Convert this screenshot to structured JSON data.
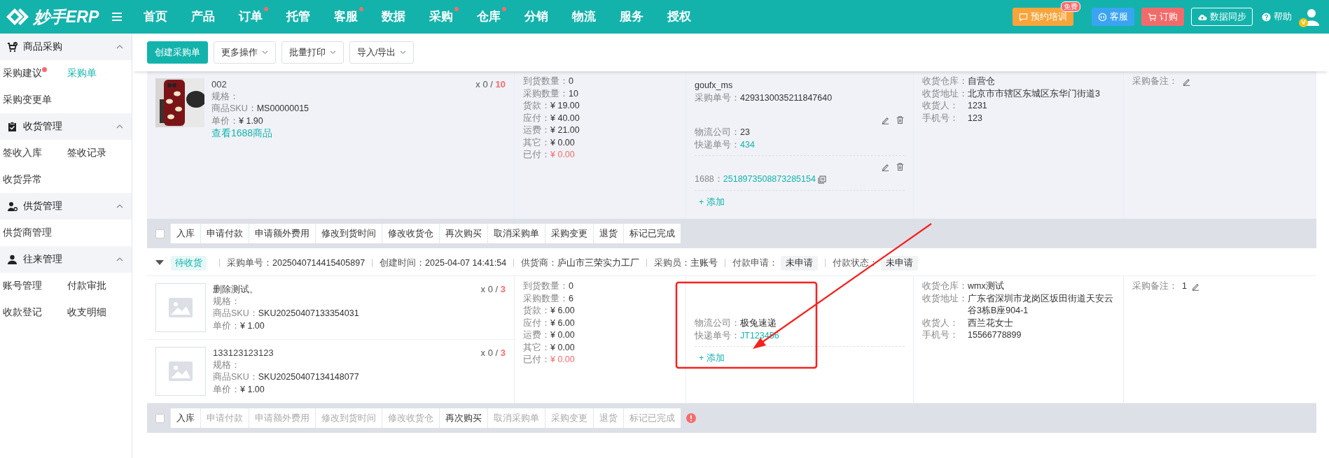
{
  "topbar": {
    "logo": "妙手ERP",
    "nav": [
      {
        "label": "首页",
        "dot": false
      },
      {
        "label": "产品",
        "dot": false
      },
      {
        "label": "订单",
        "dot": true
      },
      {
        "label": "托管",
        "dot": false
      },
      {
        "label": "客服",
        "dot": true
      },
      {
        "label": "数据",
        "dot": false
      },
      {
        "label": "采购",
        "dot": true
      },
      {
        "label": "仓库",
        "dot": true
      },
      {
        "label": "分销",
        "dot": false
      },
      {
        "label": "物流",
        "dot": false
      },
      {
        "label": "服务",
        "dot": false
      },
      {
        "label": "授权",
        "dot": false
      }
    ],
    "actions": [
      {
        "kind": "training",
        "label": "预约培训",
        "badge": "免费"
      },
      {
        "kind": "service",
        "label": "客服"
      },
      {
        "kind": "order",
        "label": "订购"
      },
      {
        "kind": "sync",
        "label": "数据同步"
      },
      {
        "kind": "help",
        "label": "帮助"
      }
    ],
    "avatar_badge": "V"
  },
  "sidebar": [
    {
      "title": "商品采购",
      "expanded": true,
      "items": [
        {
          "label": "采购建议",
          "dot": true,
          "selected": false
        },
        {
          "label": "采购单",
          "dot": false,
          "selected": true
        },
        {
          "label": "采购变更单",
          "dot": false,
          "selected": false
        }
      ]
    },
    {
      "title": "收货管理",
      "expanded": true,
      "items": [
        {
          "label": "签收入库",
          "dot": false,
          "selected": false
        },
        {
          "label": "签收记录",
          "dot": false,
          "selected": false
        },
        {
          "label": "收货异常",
          "dot": false,
          "selected": false
        }
      ]
    },
    {
      "title": "供货管理",
      "expanded": true,
      "items": [
        {
          "label": "供货商管理",
          "dot": false,
          "selected": false
        }
      ]
    },
    {
      "title": "往来管理",
      "expanded": true,
      "items": [
        {
          "label": "账号管理",
          "dot": false,
          "selected": false
        },
        {
          "label": "付款审批",
          "dot": false,
          "selected": false
        },
        {
          "label": "收款登记",
          "dot": false,
          "selected": false
        },
        {
          "label": "收支明细",
          "dot": false,
          "selected": false
        }
      ]
    }
  ],
  "toolbar": [
    {
      "label": "创建采购单",
      "kind": "primary"
    },
    {
      "label": "更多操作",
      "kind": "dropdown"
    },
    {
      "label": "批量打印",
      "kind": "dropdown"
    },
    {
      "label": "导入/导出",
      "kind": "dropdown"
    }
  ],
  "orders": [
    {
      "hovered": true,
      "products": [
        {
          "name": "002",
          "spec": "规格：",
          "sku_label": "商品SKU：",
          "sku": "MS00000015",
          "price_label": "单价：",
          "price": "¥ 1.90",
          "link": "查看1688商品",
          "quantity": "x 0 /",
          "quantity_total": "10"
        }
      ],
      "amounts": [
        {
          "label": "到货数量：",
          "value": "0",
          "alert": false
        },
        {
          "label": "采购数量：",
          "value": "10",
          "alert": false
        },
        {
          "label": "货款：",
          "value": "¥ 19.00",
          "alert": false
        },
        {
          "label": "应付：",
          "value": "¥ 40.00",
          "alert": false
        },
        {
          "label": "运费：",
          "value": "¥ 21.00",
          "alert": false
        },
        {
          "label": "其它：",
          "value": "¥ 0.00",
          "alert": false
        },
        {
          "label": "已付：",
          "value": "¥ 0.00",
          "alert": true
        }
      ],
      "logistics": {
        "account": "goufx_ms",
        "fields": [
          {
            "label": "采购单号：",
            "value": "4293130035211847640"
          }
        ],
        "shipments": [
          {
            "editable": true,
            "copyable": false,
            "fields": [
              {
                "label": "物流公司：",
                "value": "23",
                "link": false
              },
              {
                "label": "快递单号：",
                "value": "434",
                "link": true
              }
            ]
          },
          {
            "editable": true,
            "copyable": true,
            "fields": [
              {
                "label": "1688：",
                "value": "2518973508873285154",
                "link": true
              }
            ]
          }
        ],
        "add": "+ 添加"
      },
      "warehouse": [
        {
          "label": "收货仓库：",
          "value": "自营仓"
        },
        {
          "label": "收货地址：",
          "value": "北京市市辖区东城区东华门街道3"
        },
        {
          "label": "收货人：",
          "value": "1231"
        },
        {
          "label": "手机号：",
          "value": "123"
        }
      ],
      "note": {
        "label": "采购备注："
      },
      "bar": {
        "checked": false,
        "warning": false,
        "buttons": [
          {
            "label": "入库",
            "disabled": false
          },
          {
            "label": "申请付款",
            "disabled": false
          },
          {
            "label": "申请额外费用",
            "disabled": false
          },
          {
            "label": "修改到货时间",
            "disabled": false
          },
          {
            "label": "修改收货仓",
            "disabled": false
          },
          {
            "label": "再次购买",
            "disabled": false
          },
          {
            "label": "取消采购单",
            "disabled": false
          },
          {
            "label": "采购变更",
            "disabled": false
          },
          {
            "label": "退货",
            "disabled": false
          },
          {
            "label": "标记已完成",
            "disabled": false
          }
        ]
      }
    },
    {
      "hovered": false,
      "header": {
        "expanded": true,
        "status": "待收货",
        "fields": [
          {
            "label": "采购单号：",
            "value": "2025040714415405897"
          },
          {
            "label": "创建时间：",
            "value": "2025-04-07 14:41:54"
          },
          {
            "label": "供货商：",
            "value": "庐山市三荣实力工厂"
          },
          {
            "label": "采购员：",
            "value": "主账号"
          },
          {
            "label": "付款申请：",
            "chip": "未申请"
          },
          {
            "label": "付款状态：",
            "chip": "未申请"
          }
        ]
      },
      "products": [
        {
          "image": {
            "kind": "placeholder"
          },
          "name": "删除测试。",
          "spec": "规格：",
          "sku_label": "商品SKU：",
          "sku": "SKU20250407133354031",
          "price_label": "单价：",
          "price": "¥ 1.00",
          "quantity": "x 0 /",
          "quantity_total": "3"
        },
        {
          "image": {
            "kind": "placeholder"
          },
          "name": "133123123123",
          "spec": "规格：",
          "sku_label": "商品SKU：",
          "sku": "SKU20250407134148077",
          "price_label": "单价：",
          "price": "¥ 1.00",
          "quantity": "x 0 /",
          "quantity_total": "3"
        }
      ],
      "amounts": [
        {
          "label": "到货数量：",
          "value": "0",
          "alert": false
        },
        {
          "label": "采购数量：",
          "value": "6",
          "alert": false
        },
        {
          "label": "货款：",
          "value": "¥ 6.00",
          "alert": false
        },
        {
          "label": "应付：",
          "value": "¥ 6.00",
          "alert": false
        },
        {
          "label": "运费：",
          "value": "¥ 0.00",
          "alert": false
        },
        {
          "label": "其它：",
          "value": "¥ 0.00",
          "alert": false
        },
        {
          "label": "已付：",
          "value": "¥ 0.00",
          "alert": true
        }
      ],
      "logistics": {
        "shipments": [
          {
            "editable": false,
            "copyable": false,
            "fields": [
              {
                "label": "物流公司：",
                "value": "极兔速递",
                "link": false
              },
              {
                "label": "快递单号：",
                "value": "JT123456",
                "link": true
              }
            ]
          }
        ],
        "add": "+ 添加"
      },
      "warehouse": [
        {
          "label": "收货仓库：",
          "value": "wmx测试"
        },
        {
          "label": "收货地址：",
          "value": "广东省深圳市龙岗区坂田街道天安云谷3栋B座904-1"
        },
        {
          "label": "收货人：",
          "value": "西兰花女士"
        },
        {
          "label": "手机号：",
          "value": "15566778899"
        }
      ],
      "note": {
        "label": "采购备注：",
        "value": "1"
      },
      "bar": {
        "checked": false,
        "warning": true,
        "buttons": [
          {
            "label": "入库",
            "disabled": false
          },
          {
            "label": "申请付款",
            "disabled": true
          },
          {
            "label": "申请额外费用",
            "disabled": true
          },
          {
            "label": "修改到货时间",
            "disabled": true
          },
          {
            "label": "修改收货仓",
            "disabled": true
          },
          {
            "label": "再次购买",
            "disabled": false
          },
          {
            "label": "取消采购单",
            "disabled": true
          },
          {
            "label": "采购变更",
            "disabled": true
          },
          {
            "label": "退货",
            "disabled": true
          },
          {
            "label": "标记已完成",
            "disabled": true
          }
        ]
      }
    }
  ],
  "annotations": [
    {
      "kind": "box"
    },
    {
      "kind": "arrow"
    }
  ]
}
